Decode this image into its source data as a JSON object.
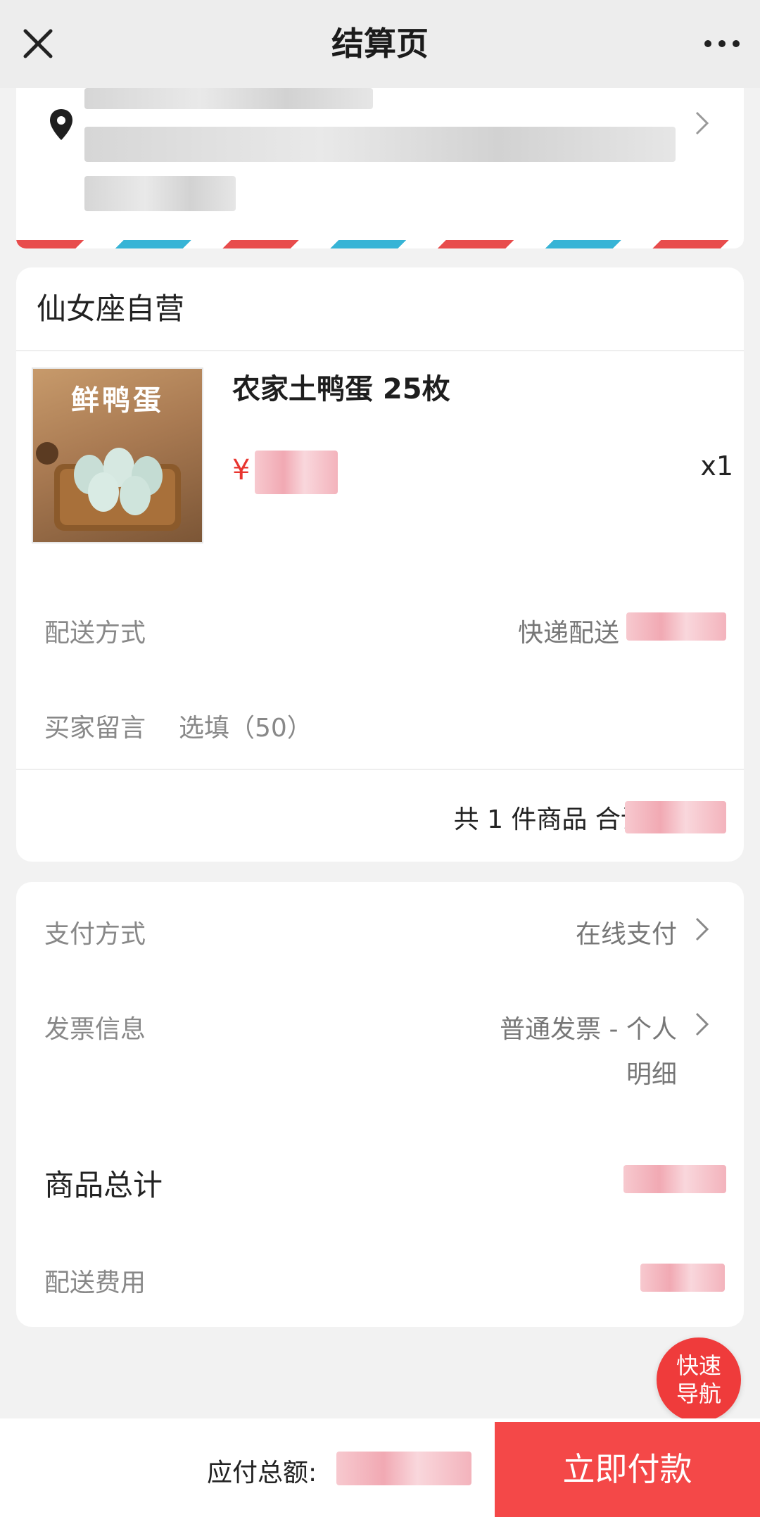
{
  "header": {
    "title": "结算页",
    "close_icon": "close-icon",
    "more_icon": "more-dots-icon"
  },
  "address": {
    "location_icon": "location-pin-icon",
    "chevron_icon": "chevron-right-icon"
  },
  "shop": {
    "name": "仙女座自营",
    "product": {
      "name": "农家土鸭蛋 25枚",
      "image_text": "鲜鸭蛋",
      "currency_symbol": "¥",
      "quantity": "x1"
    },
    "delivery": {
      "label": "配送方式",
      "value": "快递配送"
    },
    "message": {
      "label": "买家留言",
      "placeholder": "选填（50）"
    },
    "summary": "共 1 件商品 合计:"
  },
  "payment": {
    "method_label": "支付方式",
    "method_value": "在线支付",
    "invoice_label": "发票信息",
    "invoice_value_line1": "普通发票 - 个人",
    "invoice_value_line2": "明细",
    "goods_total_label": "商品总计",
    "shipping_fee_label": "配送费用"
  },
  "fab": {
    "line1": "快速",
    "line2": "导航"
  },
  "bottom": {
    "due_label": "应付总额:",
    "pay_button": "立即付款"
  },
  "colors": {
    "accent_red": "#f44848",
    "price_red": "#e8352f",
    "stripe_blue": "#37b4d6"
  }
}
